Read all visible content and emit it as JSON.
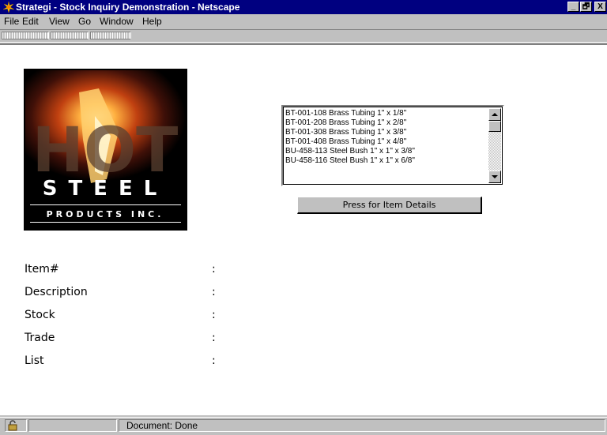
{
  "window": {
    "title": "Strategi - Stock Inquiry Demonstration - Netscape",
    "app_icon": "netscape-star-icon",
    "controls": {
      "minimize": "_",
      "restore": "🗗",
      "close": "X"
    }
  },
  "menu": {
    "items": [
      "File",
      "Edit",
      "View",
      "Go",
      "Window",
      "Help"
    ]
  },
  "logo": {
    "main_text": "STEEL",
    "sub_text": "PRODUCTS INC.",
    "graphic_text": "HOT",
    "icon": "hot-steel-products-logo"
  },
  "stock_list": {
    "items": [
      "BT-001-108  Brass Tubing 1\" x 1/8\"",
      "BT-001-208  Brass Tubing 1\" x 2/8\"",
      "BT-001-308  Brass Tubing 1\" x 3/8\"",
      "BT-001-408  Brass Tubing 1\" x 4/8\"",
      "BU-458-113  Steel Bush 1\" x 1\" x 3/8\"",
      "BU-458-116  Steel Bush 1\" x 1\" x 6/8\""
    ]
  },
  "details_button": {
    "label": "Press for Item Details"
  },
  "fields": [
    {
      "label": "Item#",
      "sep": ":"
    },
    {
      "label": "Description",
      "sep": ":"
    },
    {
      "label": "Stock",
      "sep": ":"
    },
    {
      "label": "Trade",
      "sep": ":"
    },
    {
      "label": "List",
      "sep": ":"
    }
  ],
  "status": {
    "text": "Document: Done",
    "icon": "security-lock-icon"
  }
}
